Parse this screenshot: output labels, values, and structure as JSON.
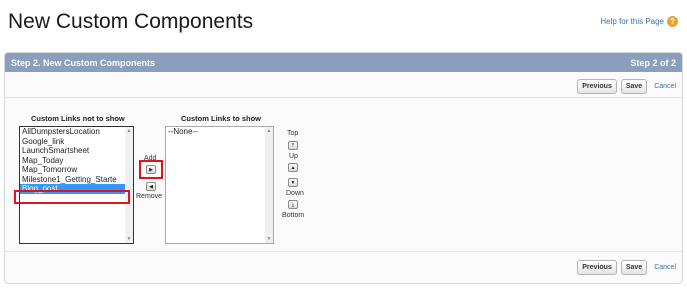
{
  "page": {
    "title": "New Custom Components",
    "help_label": "Help for this Page",
    "help_icon": "help-icon",
    "accent": "#8a9ebe",
    "highlight": "#e0141e"
  },
  "step": {
    "title": "Step 2. New Custom Components",
    "indicator": "Step 2 of 2"
  },
  "actions": {
    "previous": "Previous",
    "save": "Save",
    "cancel": "Cancel"
  },
  "available": {
    "title": "Custom Links not to show",
    "options": [
      "AllDumpstersLocation",
      "Google_link",
      "LaunchSmartsheet",
      "Map_Today",
      "Map_Tomorrow",
      "Milestone1_Getting_Starte",
      "Blog_post"
    ],
    "selected": "Blog_post"
  },
  "shown": {
    "title": "Custom Links to show",
    "options": [
      "--None--"
    ]
  },
  "transfer": {
    "add": "Add",
    "remove": "Remove"
  },
  "order": {
    "top": "Top",
    "up": "Up",
    "down": "Down",
    "bottom": "Bottom"
  }
}
